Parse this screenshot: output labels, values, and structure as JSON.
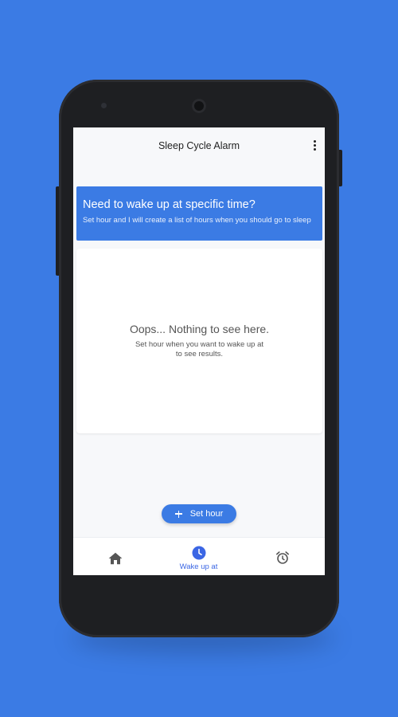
{
  "app": {
    "title": "Sleep Cycle Alarm"
  },
  "banner": {
    "title": "Need to wake up at specific time?",
    "subtitle": "Set hour and I will create a list of hours when you should go to sleep"
  },
  "empty_state": {
    "title": "Oops... Nothing to see here.",
    "line1": "Set hour when you want to wake up at",
    "line2": "to see results."
  },
  "fab": {
    "label": "Set hour",
    "icon": "plus-icon"
  },
  "bottom_nav": {
    "items": [
      {
        "id": "home",
        "label": "",
        "icon": "home-icon",
        "active": false
      },
      {
        "id": "wake-up-at",
        "label": "Wake up at",
        "icon": "clock-icon",
        "active": true
      },
      {
        "id": "alarm",
        "label": "",
        "icon": "alarm-clock-icon",
        "active": false
      }
    ]
  },
  "colors": {
    "background": "#3b7be4",
    "accent": "#3b7be4",
    "active_nav": "#3b66e4",
    "inactive_icon": "#555555",
    "screen_bg": "#f7f8fa"
  }
}
